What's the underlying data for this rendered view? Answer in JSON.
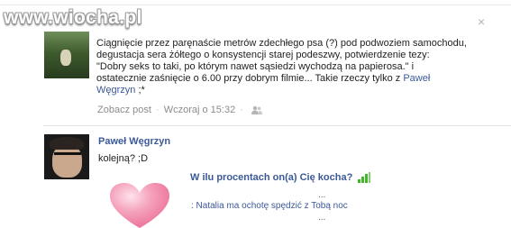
{
  "watermark": "www.wiocha.pl",
  "close_glyph": "×",
  "post": {
    "text_line1": "Ciągnięcie przez paręnaście metrów zdechłego psa (?) pod podwoziem samochodu,",
    "text_line2": "degustacja sera żółtego o konsystencji starej podeszwy, potwierdzenie tezy:",
    "text_line3": "\"Dobry seks to taki, po którym nawet sąsiedzi wychodzą na papierosa.\" i",
    "text_line4": "ostatecznie zaśnięcie o 6.00 przy dobrym filmie... Takie rzeczy tylko z",
    "tagged_name": "Paweł Węgrzyn",
    "text_end": " ;*",
    "see_post": "Zobacz post",
    "separator": "·",
    "timestamp": "Wczoraj o 15:32",
    "audience_icon": "people-icon"
  },
  "comment": {
    "author": "Paweł Węgrzyn",
    "text": "kolejną? ;D"
  },
  "quiz": {
    "title": "W ilu procentach on(a) Cię kocha?",
    "bars_icon": "signal-bars-icon",
    "heart_icon": "heart-icon",
    "ellipsis_top": "...",
    "line": ": Natalia ma ochotę spędzić z Tobą noc",
    "ellipsis_bottom": "..."
  },
  "colors": {
    "link": "#3b5998",
    "meta": "#999999",
    "heart": "#f3a0b6",
    "bars": "#42b72a"
  }
}
